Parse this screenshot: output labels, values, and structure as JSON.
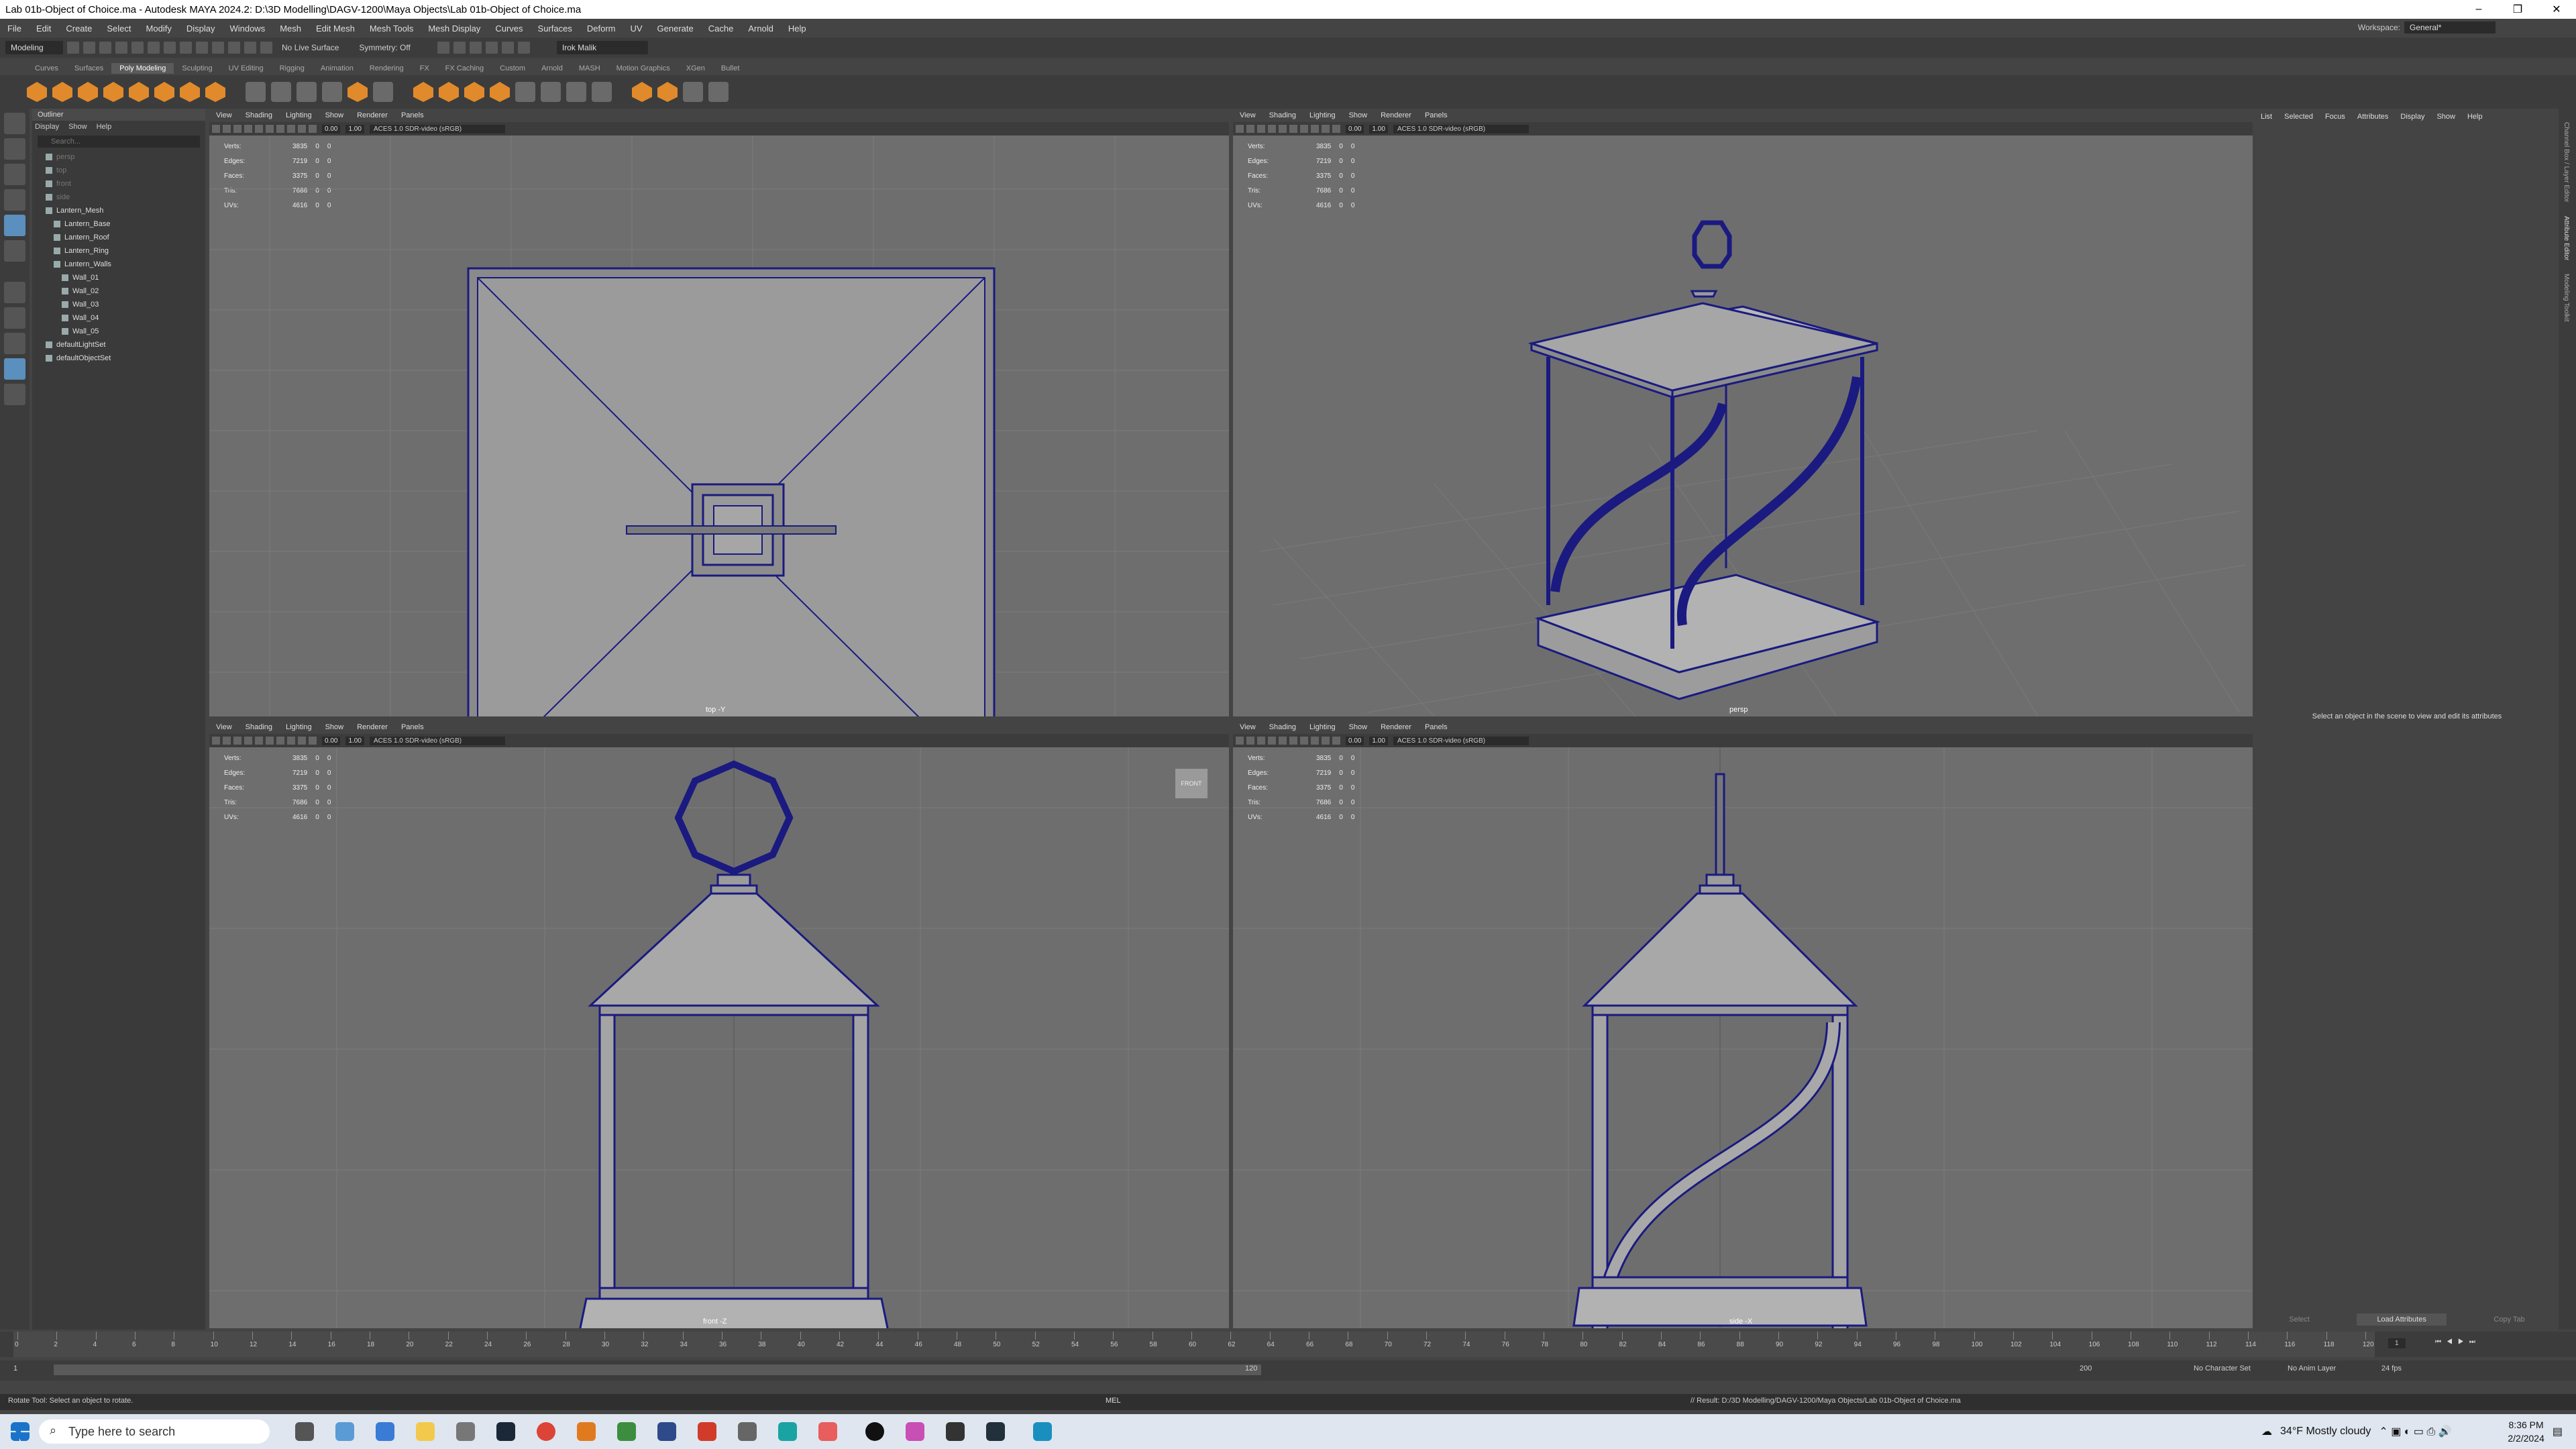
{
  "window": {
    "title": "Lab 01b-Object of Choice.ma - Autodesk MAYA 2024.2: D:\\3D Modelling\\DAGV-1200\\Maya Objects\\Lab 01b-Object of Choice.ma",
    "controls": [
      "–",
      "❐",
      "✕"
    ]
  },
  "menubar": {
    "items": [
      "File",
      "Edit",
      "Create",
      "Select",
      "Modify",
      "Display",
      "Windows",
      "Mesh",
      "Edit Mesh",
      "Mesh Tools",
      "Mesh Display",
      "Curves",
      "Surfaces",
      "Deform",
      "UV",
      "Generate",
      "Cache",
      "Arnold",
      "Help"
    ],
    "workspace_label": "Workspace:",
    "workspace_value": "General*"
  },
  "statusline": {
    "mode": "Modeling",
    "live_surface": "No Live Surface",
    "symmetry": "Symmetry: Off",
    "user": "Irok Malik"
  },
  "shelf": {
    "tabs": [
      "Curves",
      "Surfaces",
      "Poly Modeling",
      "Sculpting",
      "UV Editing",
      "Rigging",
      "Animation",
      "Rendering",
      "FX",
      "FX Caching",
      "Custom",
      "Arnold",
      "MASH",
      "Motion Graphics",
      "XGen",
      "Bullet"
    ],
    "active_tab": "Poly Modeling"
  },
  "outliner": {
    "title": "Outliner",
    "menu": [
      "Display",
      "Show",
      "Help"
    ],
    "search_placeholder": "Search...",
    "items": [
      {
        "label": "persp",
        "indent": 1,
        "dim": true
      },
      {
        "label": "top",
        "indent": 1,
        "dim": true
      },
      {
        "label": "front",
        "indent": 1,
        "dim": true
      },
      {
        "label": "side",
        "indent": 1,
        "dim": true
      },
      {
        "label": "Lantern_Mesh",
        "indent": 1,
        "dim": false
      },
      {
        "label": "Lantern_Base",
        "indent": 2,
        "dim": false
      },
      {
        "label": "Lantern_Roof",
        "indent": 2,
        "dim": false
      },
      {
        "label": "Lantern_Ring",
        "indent": 2,
        "dim": false
      },
      {
        "label": "Lantern_Walls",
        "indent": 2,
        "dim": false
      },
      {
        "label": "Wall_01",
        "indent": 3,
        "dim": false
      },
      {
        "label": "Wall_02",
        "indent": 3,
        "dim": false
      },
      {
        "label": "Wall_03",
        "indent": 3,
        "dim": false
      },
      {
        "label": "Wall_04",
        "indent": 3,
        "dim": false
      },
      {
        "label": "Wall_05",
        "indent": 3,
        "dim": false
      },
      {
        "label": "defaultLightSet",
        "indent": 1,
        "dim": false
      },
      {
        "label": "defaultObjectSet",
        "indent": 1,
        "dim": false
      }
    ]
  },
  "viewport": {
    "menu": [
      "View",
      "Shading",
      "Lighting",
      "Show",
      "Renderer",
      "Panels"
    ],
    "exposure": "0.00",
    "gamma": "1.00",
    "colorspace": "ACES 1.0 SDR-video (sRGB)",
    "hud": [
      {
        "label": "Verts:",
        "v": "3835",
        "a": "0",
        "b": "0"
      },
      {
        "label": "Edges:",
        "v": "7219",
        "a": "0",
        "b": "0"
      },
      {
        "label": "Faces:",
        "v": "3375",
        "a": "0",
        "b": "0"
      },
      {
        "label": "Tris:",
        "v": "7686",
        "a": "0",
        "b": "0"
      },
      {
        "label": "UVs:",
        "v": "4616",
        "a": "0",
        "b": "0"
      }
    ],
    "cams": {
      "top": "top -Y",
      "persp": "persp",
      "front": "front -Z",
      "side": "side -X"
    },
    "front_badge": "FRONT"
  },
  "attribute_editor": {
    "menu": [
      "List",
      "Selected",
      "Focus",
      "Attributes",
      "Display",
      "Show",
      "Help"
    ],
    "message": "Select an object in the scene to view and edit its attributes",
    "buttons": [
      "Select",
      "Load Attributes",
      "Copy Tab"
    ],
    "side_tabs": [
      "Channel Box / Layer Editor",
      "Attribute Editor",
      "Modeling Toolkit"
    ]
  },
  "timeslider": {
    "ticks": [
      0,
      2,
      4,
      6,
      8,
      10,
      12,
      14,
      16,
      18,
      20,
      22,
      24,
      26,
      28,
      30,
      32,
      34,
      36,
      38,
      40,
      42,
      44,
      46,
      48,
      50,
      52,
      54,
      56,
      58,
      60,
      62,
      64,
      66,
      68,
      70,
      72,
      74,
      76,
      78,
      80,
      82,
      84,
      86,
      88,
      90,
      92,
      94,
      96,
      98,
      100,
      102,
      104,
      106,
      108,
      110,
      112,
      114,
      116,
      118,
      120
    ],
    "current_frame": "1",
    "range_start": "1",
    "range_inner_start": "1",
    "range_inner_end": "120",
    "range_end": "200",
    "char_set": "No Character Set",
    "anim_layer": "No Anim Layer",
    "fps": "24 fps"
  },
  "commandline": {
    "lang": "MEL",
    "result": "// Result: D:/3D Modelling/DAGV-1200/Maya Objects/Lab 01b-Object of Choice.ma",
    "help": "Rotate Tool: Select an object to rotate."
  },
  "taskbar": {
    "search_placeholder": "Type here to search",
    "weather": "34°F  Mostly cloudy",
    "time": "8:36 PM",
    "date": "2/2/2024"
  },
  "colors": {
    "accent_orange": "#e08a2c",
    "wire_blue": "#1a1a80",
    "viewport_bg": "#6e6e6e",
    "selection_blue": "#5b8fbd"
  }
}
